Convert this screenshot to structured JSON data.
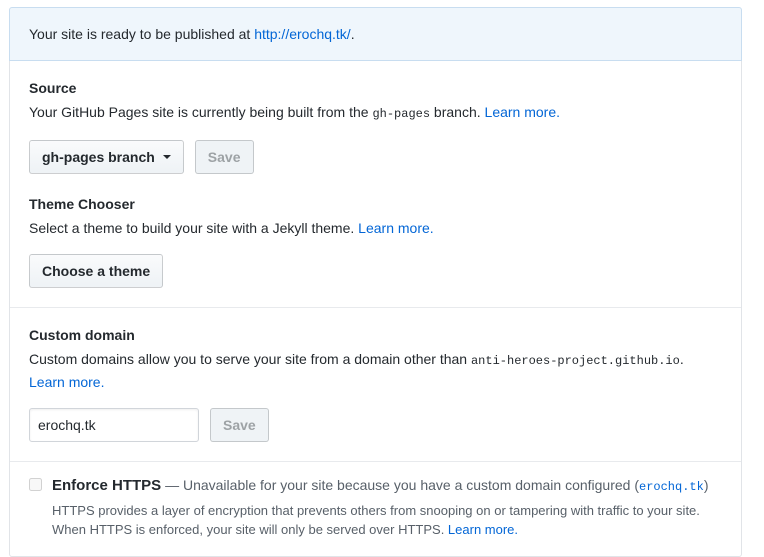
{
  "colors": {
    "link": "#0366d6",
    "text": "#24292e",
    "muted_text": "#586069",
    "flash_background": "#eff6fc",
    "flash_border": "#c8ddf0",
    "box_border": "#e1e4e8"
  },
  "banner": {
    "text_before": "Your site is ready to be published at ",
    "url_label": "http://erochq.tk/",
    "text_after": "."
  },
  "source": {
    "heading": "Source",
    "desc_before": "Your GitHub Pages site is currently being built from the ",
    "branch_code": "gh-pages",
    "desc_after": " branch. ",
    "learn_more_label": "Learn more.",
    "branch_select_label": "gh-pages branch",
    "save_label": "Save"
  },
  "theme_chooser": {
    "heading": "Theme Chooser",
    "desc": "Select a theme to build your site with a Jekyll theme. ",
    "learn_more_label": "Learn more.",
    "choose_theme_label": "Choose a theme"
  },
  "custom_domain": {
    "heading": "Custom domain",
    "desc_before": "Custom domains allow you to serve your site from a domain other than ",
    "domain_code": "anti-heroes-project.github.io",
    "desc_after": ". ",
    "learn_more_label": "Learn more.",
    "input_value": "erochq.tk",
    "save_label": "Save"
  },
  "enforce_https": {
    "label": "Enforce HTTPS",
    "unavailable_before": " — Unavailable for your site because you have a custom domain configured (",
    "domain_code": "erochq.tk",
    "unavailable_after": ")",
    "checkbox_checked": false,
    "note_line1": "HTTPS provides a layer of encryption that prevents others from snooping on or tampering with traffic to your site.",
    "note_line2": "When HTTPS is enforced, your site will only be served over HTTPS. ",
    "learn_more_label": "Learn more."
  }
}
